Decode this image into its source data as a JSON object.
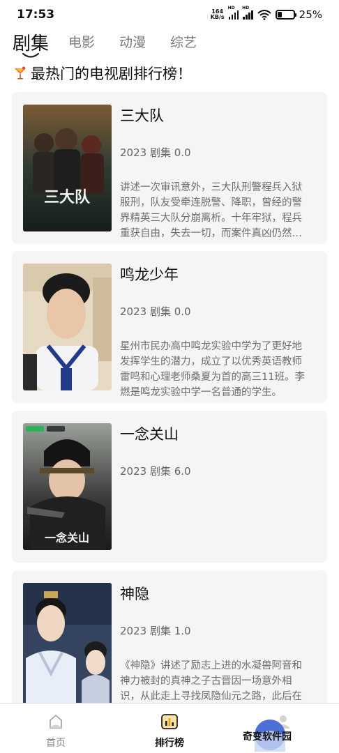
{
  "status_bar": {
    "time": "17:53",
    "net_speed_value": "164",
    "net_speed_unit": "KB/s",
    "signal_1_tag": "HD",
    "signal_2_tag": "HD",
    "battery_percent": "25%",
    "battery_level": 0.25
  },
  "tabs": [
    {
      "label": "剧集",
      "active": true
    },
    {
      "label": "电影",
      "active": false
    },
    {
      "label": "动漫",
      "active": false
    },
    {
      "label": "综艺",
      "active": false
    }
  ],
  "headline": {
    "icon": "cocktail-icon",
    "text": "最热门的电视剧排行榜！"
  },
  "shows": [
    {
      "title": "三大队",
      "meta": "2023 剧集 0.0",
      "description": "讲述一次审讯意外，三大队刑警程兵入狱服刑，队友受牵连脱警、降职，曾经的警界精英三大队分崩离析。十年牢狱，程兵重获自由，失去一切，而案件真凶仍然逍遥法外。",
      "poster_caption": "三大队",
      "poster_colors": [
        "#6b4a2a",
        "#2a3a30",
        "#1a2420"
      ]
    },
    {
      "title": "鸣龙少年",
      "meta": "2023 剧集 0.0",
      "description": "星州市民办高中鸣龙实验中学为了更好地发挥学生的潜力，成立了以优秀英语教师雷鸣和心理老师桑夏为首的高三11班。李燃是鸣龙实验中学一名普通的学生。",
      "poster_caption": "",
      "poster_colors": [
        "#e9ddc8",
        "#cfc2aa",
        "#1f2a5a"
      ]
    },
    {
      "title": "一念关山",
      "meta": "2023 剧集 6.0",
      "description": "",
      "poster_caption": "一念关山",
      "poster_colors": [
        "#8a8f8a",
        "#2b2b2b",
        "#1a1a1a"
      ]
    },
    {
      "title": "神隐",
      "meta": "2023 剧集 1.0",
      "description": "《神隐》讲述了励志上进的水凝兽阿音和神力被封的真神之子古晋因一场意外相识，从此走上寻找凤隐仙元之路，此后在插旁抑理功弃一度转分十宗流。",
      "poster_caption": "",
      "poster_colors": [
        "#3a4a66",
        "#dce4ef",
        "#b8c4d8"
      ]
    }
  ],
  "bottom_nav": [
    {
      "label": "首页",
      "icon": "home-icon",
      "active": false
    },
    {
      "label": "排行榜",
      "icon": "ranking-icon",
      "active": true
    },
    {
      "label": "",
      "icon": "profile-icon",
      "active": false
    }
  ],
  "watermark": "奇变软件园",
  "colors": {
    "card_bg": "#f5f5f5",
    "ranking_accent": "#e8a11c",
    "text_primary": "#111111",
    "text_secondary": "#666666"
  }
}
